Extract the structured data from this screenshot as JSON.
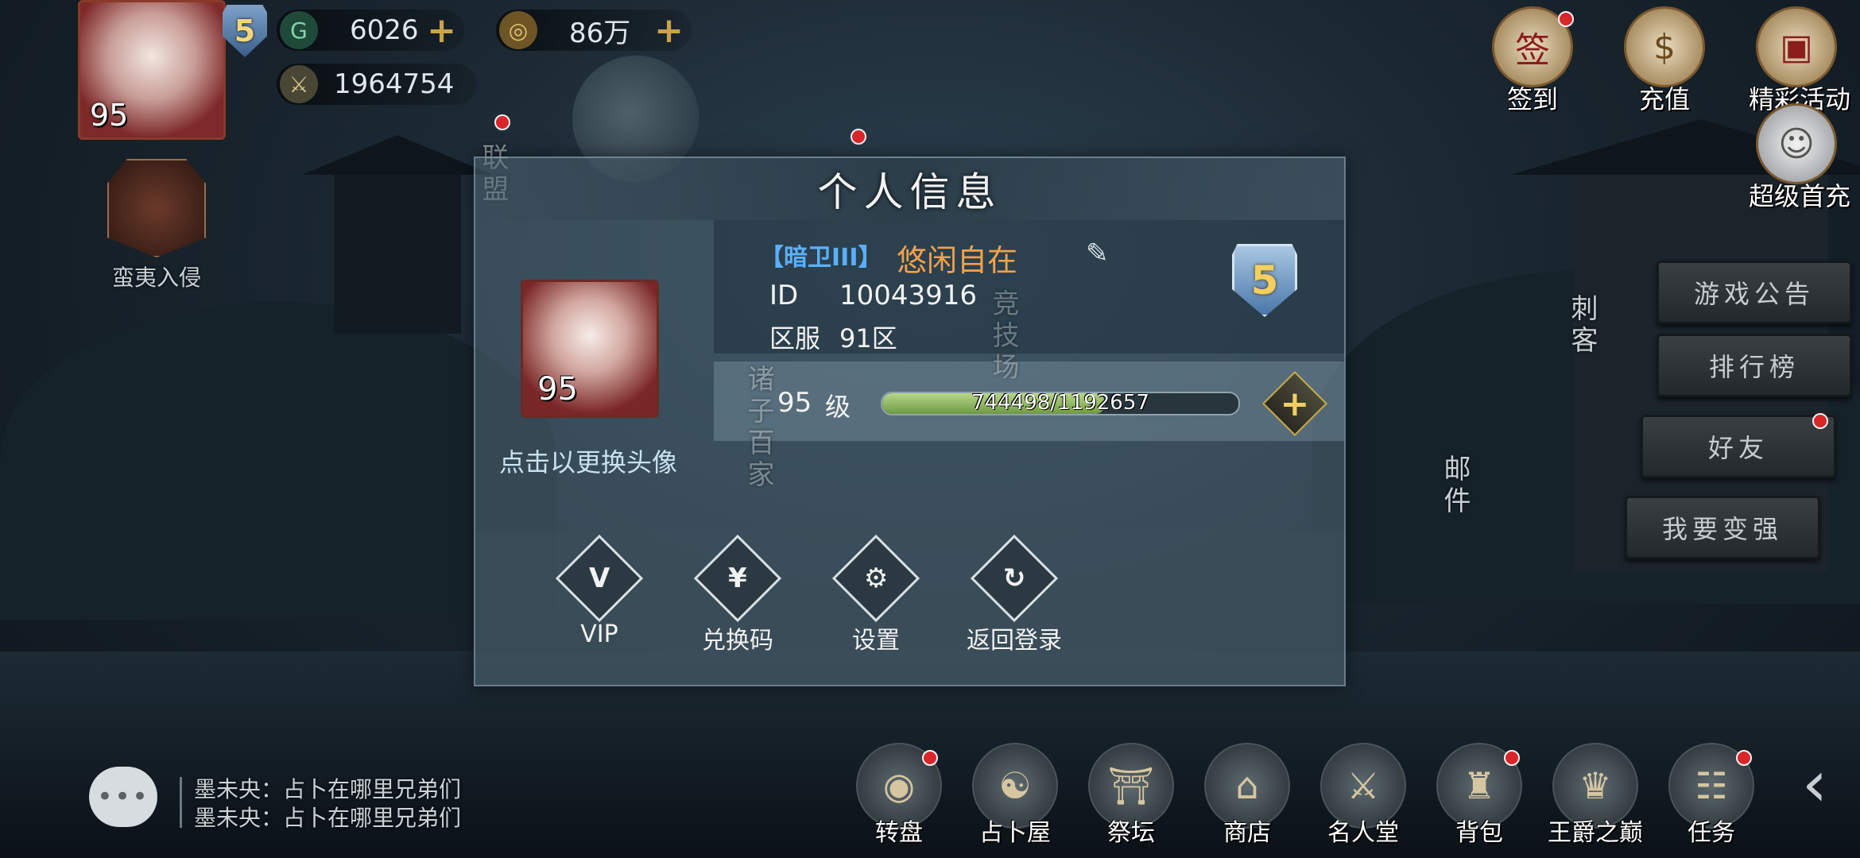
{
  "hud": {
    "avatar_level": "95",
    "vip_level": "5",
    "jade": "6026",
    "coins": "86万",
    "power": "1964754",
    "invade_label": "蛮夷入侵"
  },
  "top_right": {
    "signin": "签到",
    "recharge": "充值",
    "events": "精彩活动",
    "first_recharge": "超级首充"
  },
  "right_menu": {
    "announcement": "游戏公告",
    "ranking": "排行榜",
    "friends": "好友",
    "stronger": "我要变强",
    "assassin": "刺客",
    "mail": "邮件"
  },
  "scene_labels": {
    "alliance": "联盟",
    "hundred_schools": "诸子百家",
    "arena": "竞技场"
  },
  "profile": {
    "title": "个人信息",
    "change_avatar": "点击以更换头像",
    "portrait_level": "95",
    "guild": "【暗卫III】",
    "name": "悠闲自在",
    "id_label": "ID",
    "id_value": "10043916",
    "server_label": "区服",
    "server_value": "91区",
    "vip_badge": "5",
    "level_value": "95",
    "level_label": "级",
    "exp_text": "744498/1192657",
    "exp_fraction": 0.624,
    "actions": {
      "vip": "VIP",
      "redeem": "兑换码",
      "settings": "设置",
      "logout": "返回登录"
    }
  },
  "chat": {
    "icon_text": "•••",
    "line1": "墨未央：占卜在哪里兄弟们",
    "line2": "墨未央：占卜在哪里兄弟们"
  },
  "bottom_nav": {
    "wheel": "转盘",
    "divination": "占卜屋",
    "altar": "祭坛",
    "shop": "商店",
    "hall": "名人堂",
    "bag": "背包",
    "peak": "王爵之巅",
    "tasks": "任务"
  },
  "colors": {
    "player_name": "#f2a24a",
    "guild": "#5ab0ff",
    "notify": "#d9262a",
    "exp_fill": "#8fbf5a"
  }
}
